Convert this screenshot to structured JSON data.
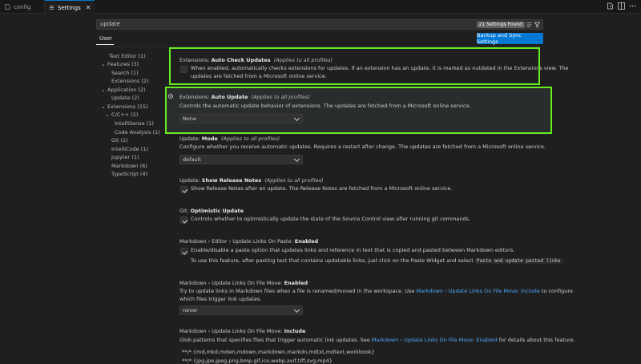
{
  "tabs": [
    {
      "label": "config",
      "icon": "file-icon"
    },
    {
      "label": "Settings",
      "icon": "settings-icon",
      "active": true
    }
  ],
  "search": {
    "value": "update",
    "found_badge": "21 Settings Found"
  },
  "scope_tab": "User",
  "sync_button": "Backup and Sync Settings",
  "toc": [
    {
      "label": "Text Editor (1)"
    },
    {
      "label": "Features (3)",
      "expanded": true
    },
    {
      "label": "Search (1)"
    },
    {
      "label": "Extensions (2)"
    },
    {
      "label": "Application (2)",
      "expanded": true
    },
    {
      "label": "Update (2)"
    },
    {
      "label": "Extensions (15)",
      "expanded": true
    },
    {
      "label": "C/C++ (2)",
      "expanded": true
    },
    {
      "label": "IntelliSense (1)"
    },
    {
      "label": "Code Analysis (1)"
    },
    {
      "label": "Git (1)"
    },
    {
      "label": "IntelliCode (1)"
    },
    {
      "label": "Jupyter (1)"
    },
    {
      "label": "Markdown (6)"
    },
    {
      "label": "TypeScript (4)"
    }
  ],
  "settings": {
    "auto_check": {
      "category": "Extensions: ",
      "name": "Auto Check Updates",
      "scope": "(Applies to all profiles)",
      "desc1": "When enabled, automatically checks extensions for updates. If an extension has an update, it is marked as outdated in the Extensions view. The",
      "desc2": "updates are fetched from a Microsoft online service.",
      "checked": false
    },
    "auto_update": {
      "category": "Extensions: ",
      "name": "Auto Update",
      "scope": "(Applies to all profiles)",
      "desc": "Controls the automatic update behavior of extensions. The updates are fetched from a Microsoft online service.",
      "value": "None"
    },
    "update_mode": {
      "category": "Update: ",
      "name": "Mode",
      "scope": "(Applies to all profiles)",
      "desc": "Configure whether you receive automatic updates. Requires a restart after change. The updates are fetched from a Microsoft online service.",
      "value": "default"
    },
    "release_notes": {
      "category": "Update: ",
      "name": "Show Release Notes",
      "scope": "(Applies to all profiles)",
      "desc": "Show Release Notes after an update. The Release Notes are fetched from a Microsoft online service.",
      "checked": true
    },
    "git_optimistic": {
      "category": "Git: ",
      "name": "Optimistic Update",
      "desc": "Controls whether to optimistically update the state of the Source Control view after running git commands.",
      "checked": true
    },
    "md_paste": {
      "category": "Markdown › Editor › Update Links On Paste: ",
      "name": "Enabled",
      "desc1": "Enable/disable a paste option that updates links and reference in text that is copied and pasted between Markdown editors.",
      "desc2_pre": "To use this feature, after pasting text that contains updatable links, just click on the Paste Widget and select ",
      "desc2_code": "Paste and update pasted links",
      "desc2_post": ".",
      "checked": true
    },
    "md_file_move": {
      "category": "Markdown › Update Links On File Move: ",
      "name": "Enabled",
      "desc1_pre": "Try to update links in Markdown files when a file is renamed/moved in the workspace. Use ",
      "desc1_link": "Markdown › Update Links On File Move: Include",
      "desc1_post": " to configure",
      "desc2": "which files trigger link updates.",
      "value": "never"
    },
    "md_include": {
      "category": "Markdown › Update Links On File Move: ",
      "name": "Include",
      "desc_pre": "Glob patterns that specifies files that trigger automatic link updates. See ",
      "desc_link": "Markdown › Update Links On File Move: Enabled",
      "desc_post": " for details about this feature.",
      "pattern1": "**/*.{md,mkd,mdwn,mdown,markdown,markdn,mdtxt,mdtext,workbook}",
      "pattern2": "**/*.{jpg,jpe,jpeg,png,bmp,gif,ico,webp,avif,tiff,svg,mp4}"
    }
  },
  "colors": {
    "accent": "#0078d4",
    "highlight": "#66ee22",
    "link": "#4daafc"
  }
}
